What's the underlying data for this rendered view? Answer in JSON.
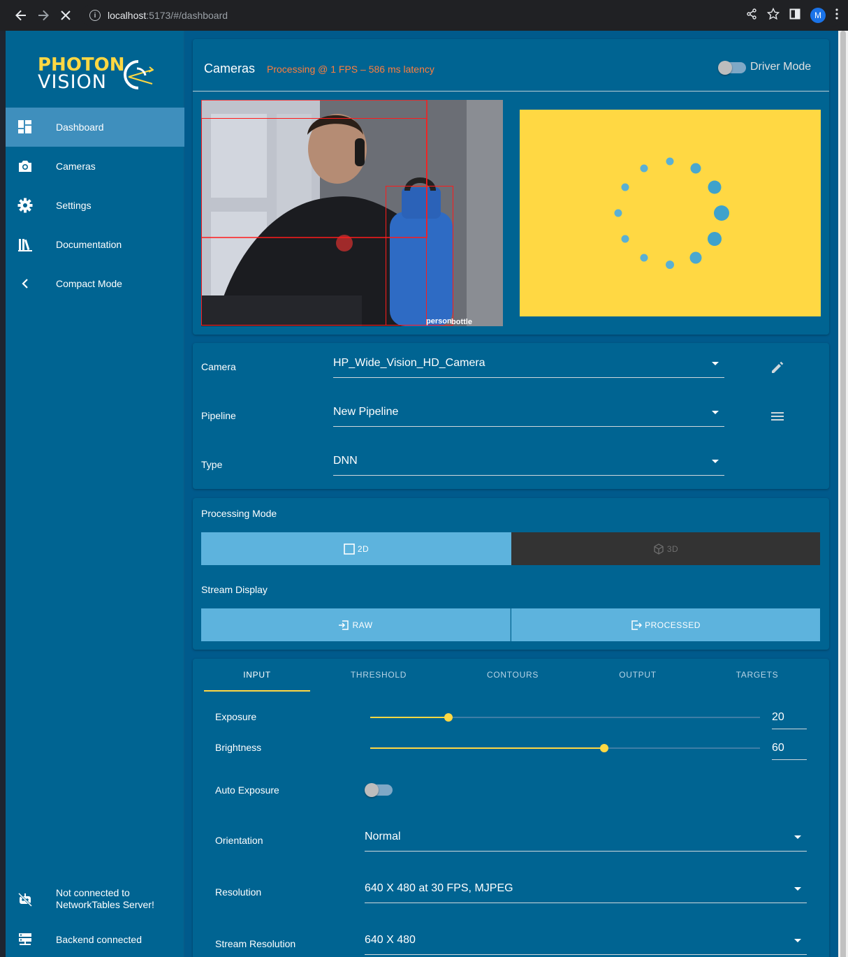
{
  "browser": {
    "url_host": "localhost",
    "url_path": ":5173/#/dashboard",
    "avatar_letter": "M"
  },
  "sidebar": {
    "logo_top": "PHOTON",
    "logo_bottom": "VISION",
    "items": [
      {
        "label": "Dashboard",
        "icon": "dashboard-icon",
        "active": true
      },
      {
        "label": "Cameras",
        "icon": "camera-icon"
      },
      {
        "label": "Settings",
        "icon": "gear-icon"
      },
      {
        "label": "Documentation",
        "icon": "library-icon"
      },
      {
        "label": "Compact Mode",
        "icon": "chevron-left-icon"
      }
    ],
    "status": {
      "networktables_line1": "Not connected to",
      "networktables_line2": "NetworkTables Server!",
      "backend": "Backend connected"
    }
  },
  "cameras_card": {
    "title": "Cameras",
    "status": "Processing @ 1 FPS – 586 ms latency",
    "driver_mode_label": "Driver Mode",
    "detections": [
      {
        "label": "person"
      },
      {
        "label": "bottle"
      }
    ]
  },
  "config": {
    "camera_label": "Camera",
    "camera_value": "HP_Wide_Vision_HD_Camera",
    "pipeline_label": "Pipeline",
    "pipeline_value": "New Pipeline",
    "type_label": "Type",
    "type_value": "DNN"
  },
  "modes": {
    "processing_mode_label": "Processing Mode",
    "mode_2d": "2D",
    "mode_3d": "3D",
    "stream_display_label": "Stream Display",
    "raw": "RAW",
    "processed": "PROCESSED"
  },
  "tabs": [
    "INPUT",
    "THRESHOLD",
    "CONTOURS",
    "OUTPUT",
    "TARGETS"
  ],
  "input": {
    "exposure_label": "Exposure",
    "exposure_value": "20",
    "exposure_fraction": 0.2,
    "brightness_label": "Brightness",
    "brightness_value": "60",
    "brightness_fraction": 0.6,
    "auto_exposure_label": "Auto Exposure",
    "orientation_label": "Orientation",
    "orientation_value": "Normal",
    "resolution_label": "Resolution",
    "resolution_value": "640 X 480 at 30 FPS, MJPEG",
    "stream_resolution_label": "Stream Resolution",
    "stream_resolution_value": "640 X 480"
  },
  "colors": {
    "accent": "#ffd843",
    "status_text": "#ff7e3d",
    "primary": "#006492",
    "button_light": "#5db3dd",
    "button_dark": "#333333"
  }
}
